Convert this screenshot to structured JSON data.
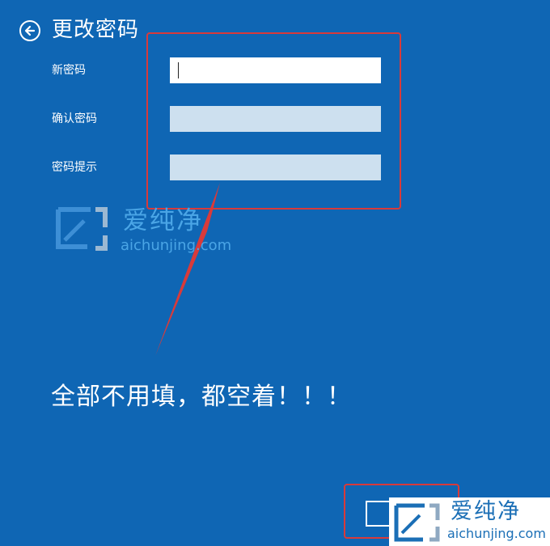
{
  "header": {
    "title": "更改密码"
  },
  "fields": [
    {
      "label": "新密码",
      "value": ""
    },
    {
      "label": "确认密码",
      "value": ""
    },
    {
      "label": "密码提示",
      "value": ""
    }
  ],
  "annotation": {
    "text": "全部不用填，都空着！！！"
  },
  "watermark": {
    "name": "爱纯净",
    "domain": "aichunjing.com"
  },
  "colors": {
    "background": "#0f66b4",
    "highlight": "#d93a3a",
    "input_inactive": "#cde0ef"
  }
}
